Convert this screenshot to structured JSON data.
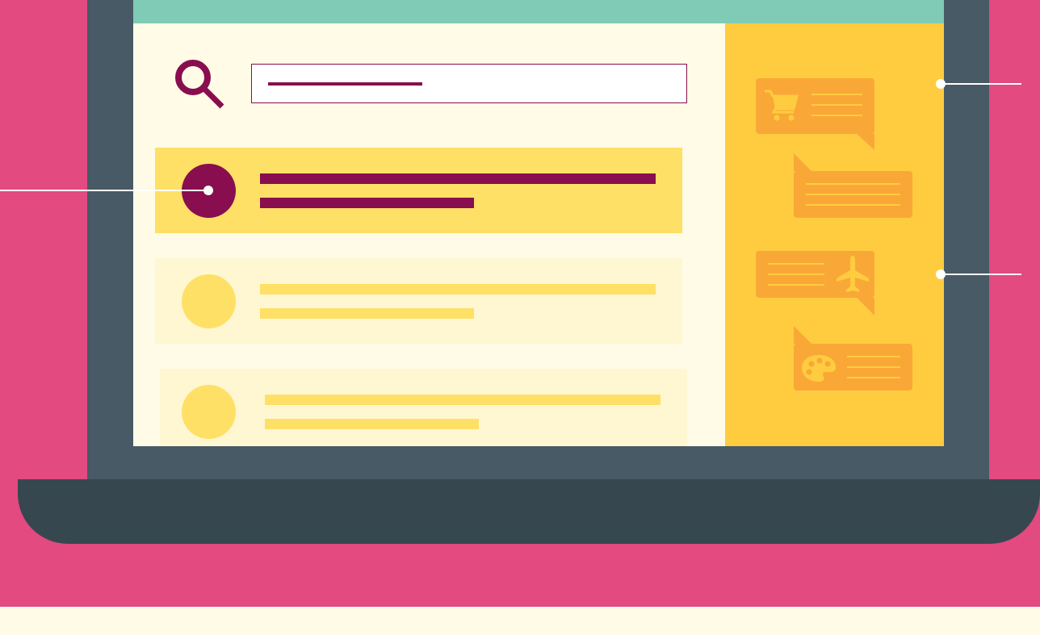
{
  "colors": {
    "background": "#E24A80",
    "floor": "#FFFBE6",
    "laptop_bezel": "#475A66",
    "laptop_base": "#37474F",
    "screen_header": "#80CBB5",
    "screen_main": "#FFFBE6",
    "sidebar": "#FFCC40",
    "accent": "#880E4F",
    "result_highlight": "#FFE066",
    "result_muted": "#FFF7D1",
    "result_muted_shape": "#FFE066",
    "bubble": "#F9A837",
    "bubble_lines": "#FFCC40",
    "callout_line": "#FFFFFF"
  },
  "search": {
    "value": "",
    "placeholder": ""
  },
  "results": [
    {
      "state": "selected"
    },
    {
      "state": "default"
    },
    {
      "state": "default"
    }
  ],
  "sidebar": {
    "bubbles": [
      {
        "icon": "shopping-cart-icon",
        "side": "left"
      },
      {
        "icon": "",
        "side": "right"
      },
      {
        "icon": "airplane-icon",
        "side": "left"
      },
      {
        "icon": "palette-icon",
        "side": "right"
      }
    ]
  }
}
